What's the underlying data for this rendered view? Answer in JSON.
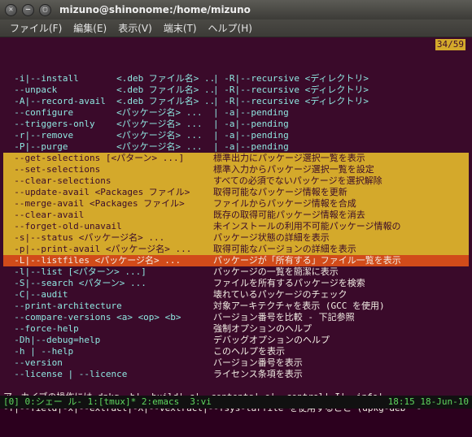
{
  "window": {
    "title": "mizuno@shinonome:/home/mizuno"
  },
  "menubar": [
    "ファイル(F)",
    "編集(E)",
    "表示(V)",
    "端末(T)",
    "ヘルプ(H)"
  ],
  "counter": "34/59",
  "top_lines": [
    {
      "l": "  -i|--install       <.deb ファイル名> ...",
      "r": "| -R|--recursive <ディレクトリ>"
    },
    {
      "l": "  --unpack           <.deb ファイル名> ...",
      "r": "| -R|--recursive <ディレクトリ>"
    },
    {
      "l": "  -A|--record-avail  <.deb ファイル名> ...",
      "r": "| -R|--recursive <ディレクトリ>"
    },
    {
      "l": "  --configure        <パッケージ名> ...",
      "r": "| -a|--pending"
    },
    {
      "l": "  --triggers-only    <パッケージ名> ...",
      "r": "| -a|--pending"
    },
    {
      "l": "  -r|--remove        <パッケージ名> ...",
      "r": "| -a|--pending"
    },
    {
      "l": "  -P|--purge         <パッケージ名> ...",
      "r": "| -a|--pending"
    }
  ],
  "hl_lines": [
    {
      "l": "  --get-selections [<パターン> ...]",
      "r": "標準出力にパッケージ選択一覧を表示"
    },
    {
      "l": "  --set-selections",
      "r": "標準入力からパッケージ選択一覧を設定"
    },
    {
      "l": "  --clear-selections",
      "r": "すべての必須でないパッケージを選択解除"
    },
    {
      "l": "  --update-avail <Packages ファイル>",
      "r": "取得可能なパッケージ情報を更新"
    },
    {
      "l": "  --merge-avail <Packages ファイル>",
      "r": "ファイルからパッケージ情報を合成"
    },
    {
      "l": "  --clear-avail",
      "r": "既存の取得可能パッケージ情報を消去"
    },
    {
      "l": "  --forget-old-unavail",
      "r": "未インストールの利用不可能パッケージ情報の"
    },
    {
      "l": "  -s|--status <パッケージ名> ...",
      "r": "パッケージ状態の詳細を表示"
    },
    {
      "l": "  -p|--print-avail <パッケージ名> ...",
      "r": "取得可能なバージョンの詳細を表示"
    }
  ],
  "orange_line": {
    "l": "  -L|--listfiles <パッケージ名> ...",
    "r": "パッケージが「所有する」ファイル一覧を表示"
  },
  "after_lines": [
    {
      "l": "  -l|--list [<パターン> ...]",
      "r": "パッケージの一覧を簡潔に表示"
    },
    {
      "l": "  -S|--search <パターン> ...",
      "r": "ファイルを所有するパッケージを検索"
    },
    {
      "l": "  -C|--audit",
      "r": "壊れているパッケージのチェック"
    },
    {
      "l": "  --print-architecture",
      "r": "対象アーキテクチャを表示 (GCC を使用)"
    },
    {
      "l": "  --compare-versions <a> <op> <b>",
      "r": "バージョン番号を比較 - 下記参照"
    },
    {
      "l": "  --force-help",
      "r": "強制オプションのヘルプ"
    },
    {
      "l": "  -Dh|--debug=help",
      "r": "デバッグオプションのヘルプ"
    },
    {
      "l": "",
      "r": ""
    },
    {
      "l": "  -h | --help",
      "r": "このヘルプを表示"
    },
    {
      "l": "  --version",
      "r": "バージョン番号を表示"
    },
    {
      "l": "  --license | --licence",
      "r": "ライセンス条項を表示"
    }
  ],
  "footer1": "アーカイブの操作には dpkg -b|--build|-c|--contents|-e|--control|-I|--info|",
  "footer2": "-f|--field|-x|--extract|-X|--vextract|--fsys-tarfile を使用すること (dpkg-deb  -",
  "status": {
    "left": "[0] 0:シェー ル- 1:[tmux]* 2:emacs  3:vi",
    "right": "18:15 18-Jun-10"
  }
}
